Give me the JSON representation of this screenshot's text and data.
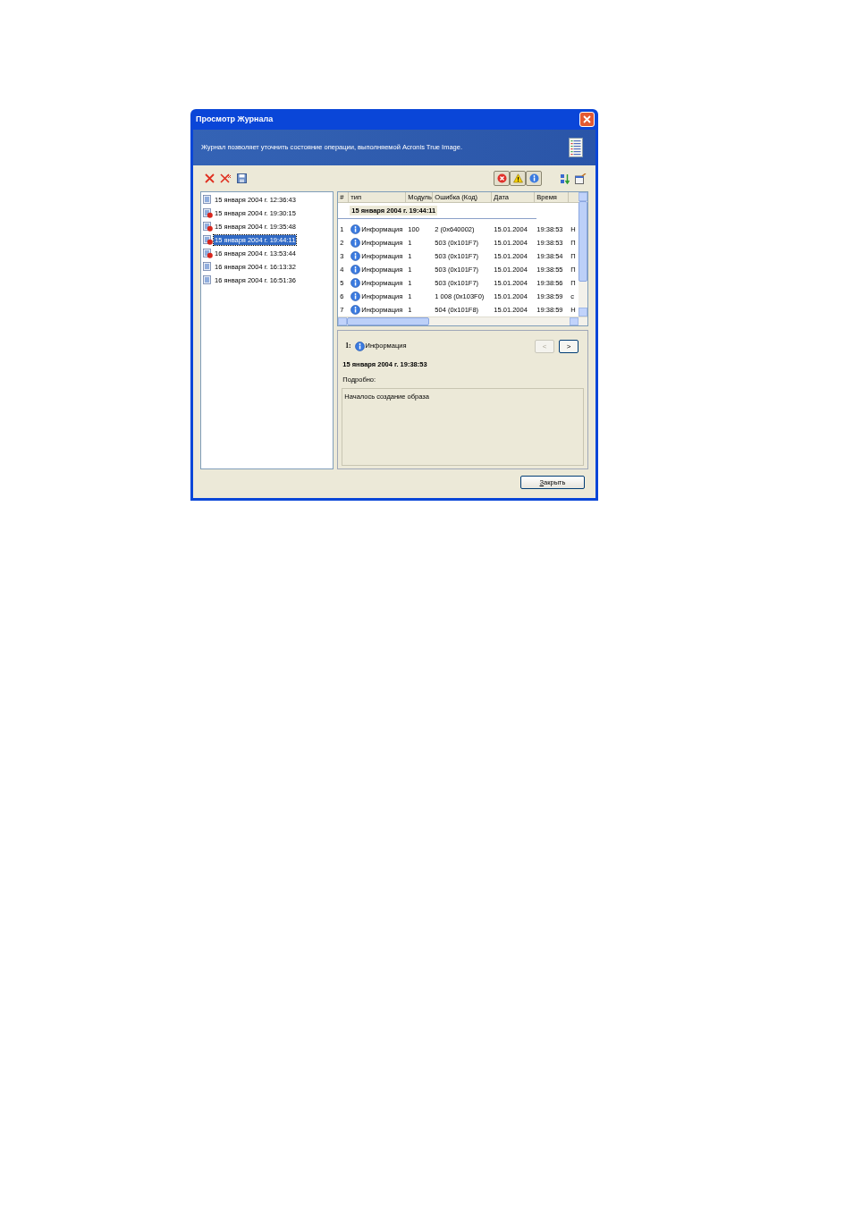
{
  "window": {
    "title": "Просмотр Журнала",
    "description": "Журнал позволяет уточнить состояние операции, выполняемой Acronis True Image."
  },
  "filters": [
    {
      "kind": "error",
      "selected": true
    },
    {
      "kind": "warning",
      "selected": true
    },
    {
      "kind": "info",
      "selected": true
    }
  ],
  "logs": [
    {
      "kind": "ok",
      "label": "15 января 2004 г. 12:36:43",
      "selected": false
    },
    {
      "kind": "error",
      "label": "15 января 2004 г. 19:30:15",
      "selected": false
    },
    {
      "kind": "error",
      "label": "15 января 2004 г. 19:35:48",
      "selected": false
    },
    {
      "kind": "error",
      "label": "15 января 2004 г. 19:44:11",
      "selected": true
    },
    {
      "kind": "error",
      "label": "16 января 2004 г. 13:53:44",
      "selected": false
    },
    {
      "kind": "ok",
      "label": "16 января 2004 г. 16:13:32",
      "selected": false
    },
    {
      "kind": "ok",
      "label": "16 января 2004 г. 16:51:36",
      "selected": false
    }
  ],
  "table": {
    "columns": [
      "#",
      "тип",
      "Модуль",
      "Ошибка (Код)",
      "Дата",
      "Время"
    ],
    "group_header": "15 января 2004 г. 19:44:11",
    "rows": [
      {
        "cells": [
          "1",
          "Информация",
          "100",
          "2 (0x640002)",
          "15.01.2004",
          "19:38:53",
          "Н"
        ]
      },
      {
        "cells": [
          "2",
          "Информация",
          "1",
          "503 (0x101F7)",
          "15.01.2004",
          "19:38:53",
          "П"
        ]
      },
      {
        "cells": [
          "3",
          "Информация",
          "1",
          "503 (0x101F7)",
          "15.01.2004",
          "19:38:54",
          "П"
        ]
      },
      {
        "cells": [
          "4",
          "Информация",
          "1",
          "503 (0x101F7)",
          "15.01.2004",
          "19:38:55",
          "П"
        ]
      },
      {
        "cells": [
          "5",
          "Информация",
          "1",
          "503 (0x101F7)",
          "15.01.2004",
          "19:38:56",
          "П"
        ]
      },
      {
        "cells": [
          "6",
          "Информация",
          "1",
          "1 008 (0x103F0)",
          "15.01.2004",
          "19:38:59",
          "с"
        ]
      },
      {
        "cells": [
          "7",
          "Информация",
          "1",
          "504 (0x101F8)",
          "15.01.2004",
          "19:38:59",
          "Н"
        ]
      }
    ]
  },
  "details": {
    "index": "1:",
    "type": "Информация",
    "timestamp": "15 января 2004 г. 19:38:53",
    "label": "Подробно:",
    "text": "Началось создание образа",
    "prev": {
      "label": "<",
      "disabled": true
    },
    "next": {
      "label": ">",
      "disabled": false
    }
  },
  "close_button": "Закрыть"
}
